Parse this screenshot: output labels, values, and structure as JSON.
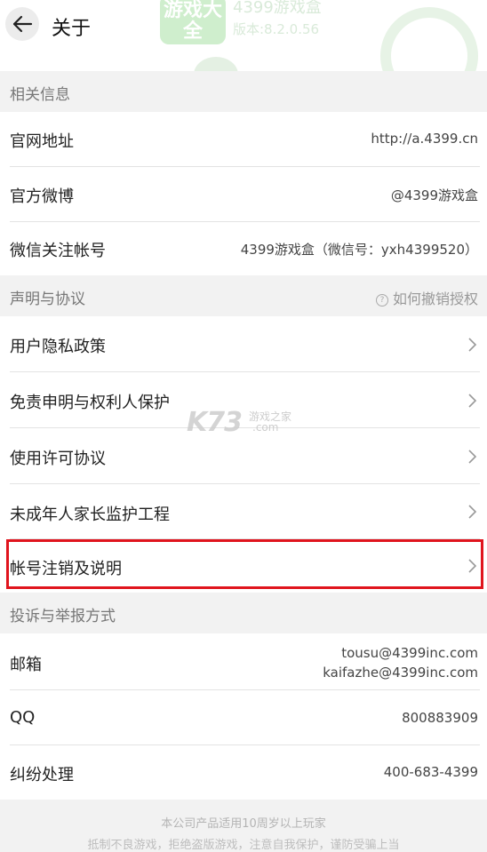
{
  "header": {
    "back_icon": "arrow-left-icon",
    "title": "关于",
    "app_logo_text": "游戏大全",
    "app_name": "4399游戏盒",
    "app_version": "版本:8.2.0.56"
  },
  "related_info": {
    "header": "相关信息",
    "rows": [
      {
        "label": "官网地址",
        "value": "http://a.4399.cn"
      },
      {
        "label": "官方微博",
        "value": "@4399游戏盒"
      },
      {
        "label": "微信关注帐号",
        "value": "4399游戏盒（微信号：yxh4399520）"
      }
    ]
  },
  "agreements": {
    "header": "声明与协议",
    "revoke_link": "如何撤销授权",
    "help_icon": "question-circle-icon",
    "rows": [
      {
        "label": "用户隐私政策"
      },
      {
        "label": "免责申明与权利人保护"
      },
      {
        "label": "使用许可协议"
      },
      {
        "label": "未成年人家长监护工程"
      },
      {
        "label": "帐号注销及说明"
      }
    ],
    "chevron_icon": "chevron-right-icon"
  },
  "complaints": {
    "header": "投诉与举报方式",
    "email": {
      "label": "邮箱",
      "value_1": "tousu@4399inc.com",
      "value_2": "kaifazhe@4399inc.com"
    },
    "qq": {
      "label": "QQ",
      "value": "800883909"
    },
    "dispute": {
      "label": "纠纷处理",
      "value": "400-683-4399"
    }
  },
  "watermark": {
    "main": "K73",
    "sub_1": "游戏之家",
    "sub_2": ".com"
  },
  "footer": {
    "line_1": "本公司产品适用10周岁以上玩家",
    "line_2": "抵制不良游戏，拒绝盗版游戏，注意自我保护，谨防受骗上当"
  },
  "colors": {
    "highlight": "#e0141d",
    "background": "#f2f2f2",
    "brand_green": "#3cb83c"
  }
}
